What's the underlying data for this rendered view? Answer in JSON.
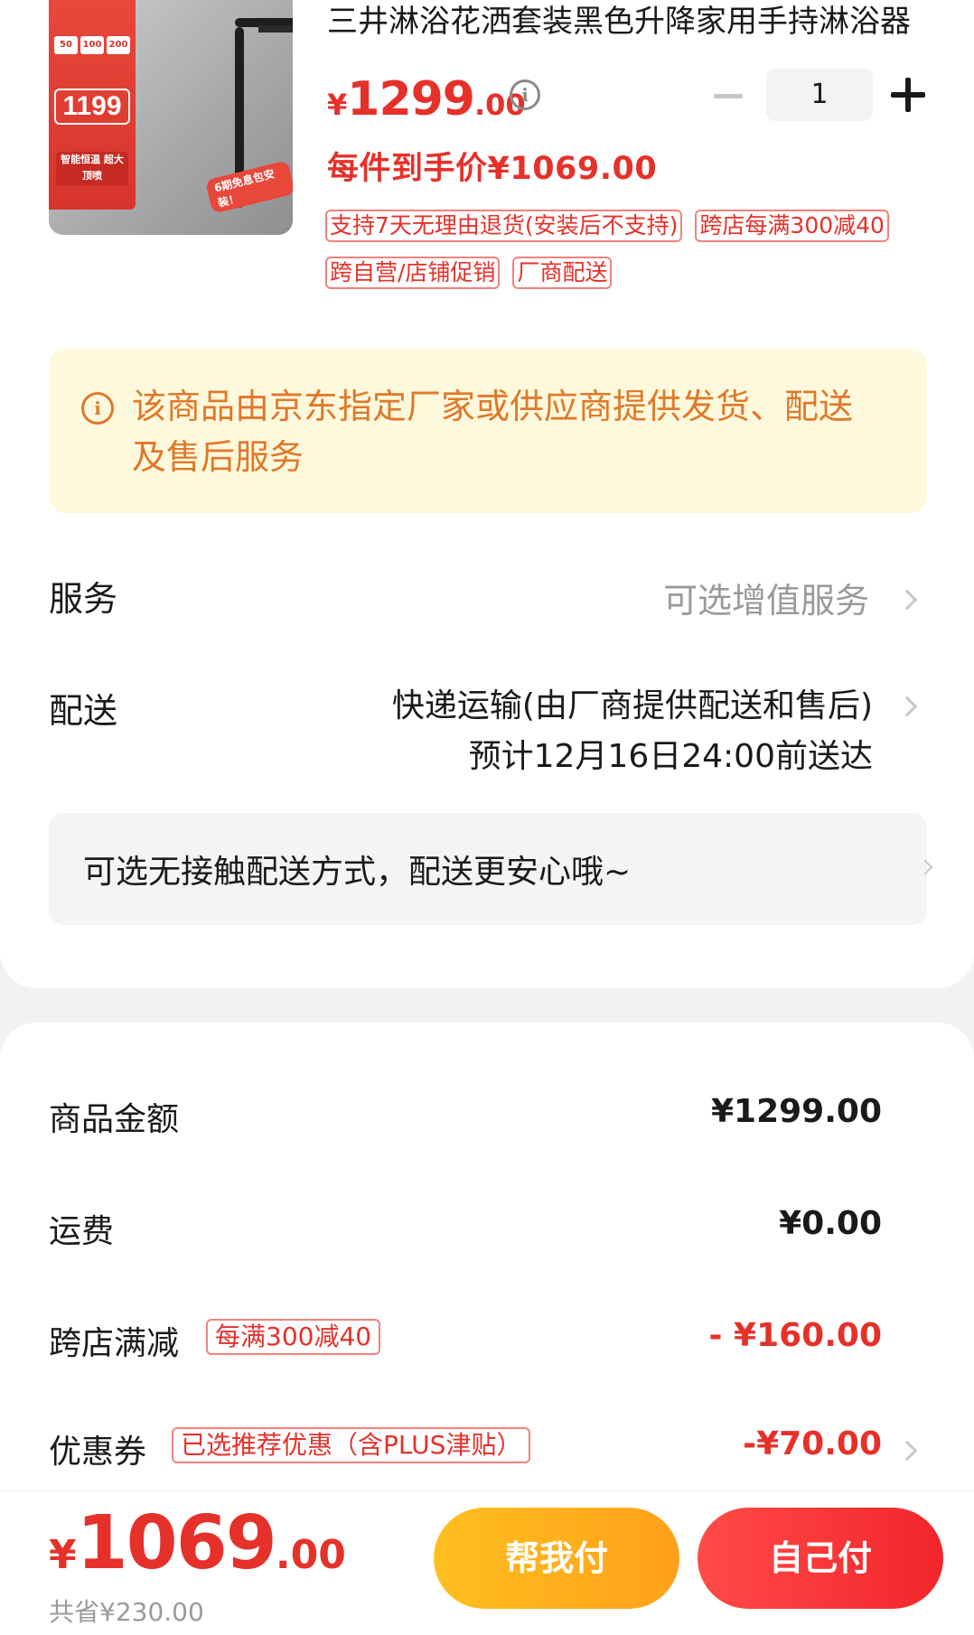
{
  "product": {
    "image_banner_price": "1199",
    "image_banner_chips": [
      "50",
      "100",
      "200"
    ],
    "image_banner_feature": "智能恒温 超大顶喷",
    "image_tag": "6期免息包安装！",
    "title": "三井淋浴花洒套装黑色升降家用手持淋浴器",
    "price_currency": "¥",
    "price_int": "1299",
    "price_dec": ".00",
    "final_price": "每件到手价¥1069.00",
    "quantity": "1",
    "tags": [
      "支持7天无理由退货(安装后不支持)",
      "跨店每满300减40",
      "跨自营/店铺促销",
      "厂商配送"
    ]
  },
  "notice": {
    "text": "该商品由京东指定厂家或供应商提供发货、配送及售后服务"
  },
  "service": {
    "label": "服务",
    "value": "可选增值服务"
  },
  "delivery": {
    "label": "配送",
    "method": "快递运输(由厂商提供配送和售后)",
    "eta": "预计12月16日24:00前送达",
    "contactless": "可选无接触配送方式，配送更安心哦~"
  },
  "summary": {
    "goods_label": "商品金额",
    "goods_value": "¥1299.00",
    "shipping_label": "运费",
    "shipping_value": "¥0.00",
    "cross_label": "跨店满减",
    "cross_chip": "每满300减40",
    "cross_value": "- ¥160.00",
    "coupon_label": "优惠券",
    "coupon_chip": "已选推荐优惠（含PLUS津贴）",
    "coupon_value": "-¥70.00"
  },
  "footer": {
    "total_currency": "¥",
    "total_int": "1069",
    "total_dec": ".00",
    "saved": "共省¥230.00",
    "help_pay": "帮我付",
    "self_pay": "自己付"
  },
  "colors": {
    "accent_red": "#e5312a",
    "notice_bg": "#fef9dc",
    "notice_text": "#e0782a",
    "help_button": "#ffb01c",
    "self_button": "#f2252a"
  }
}
